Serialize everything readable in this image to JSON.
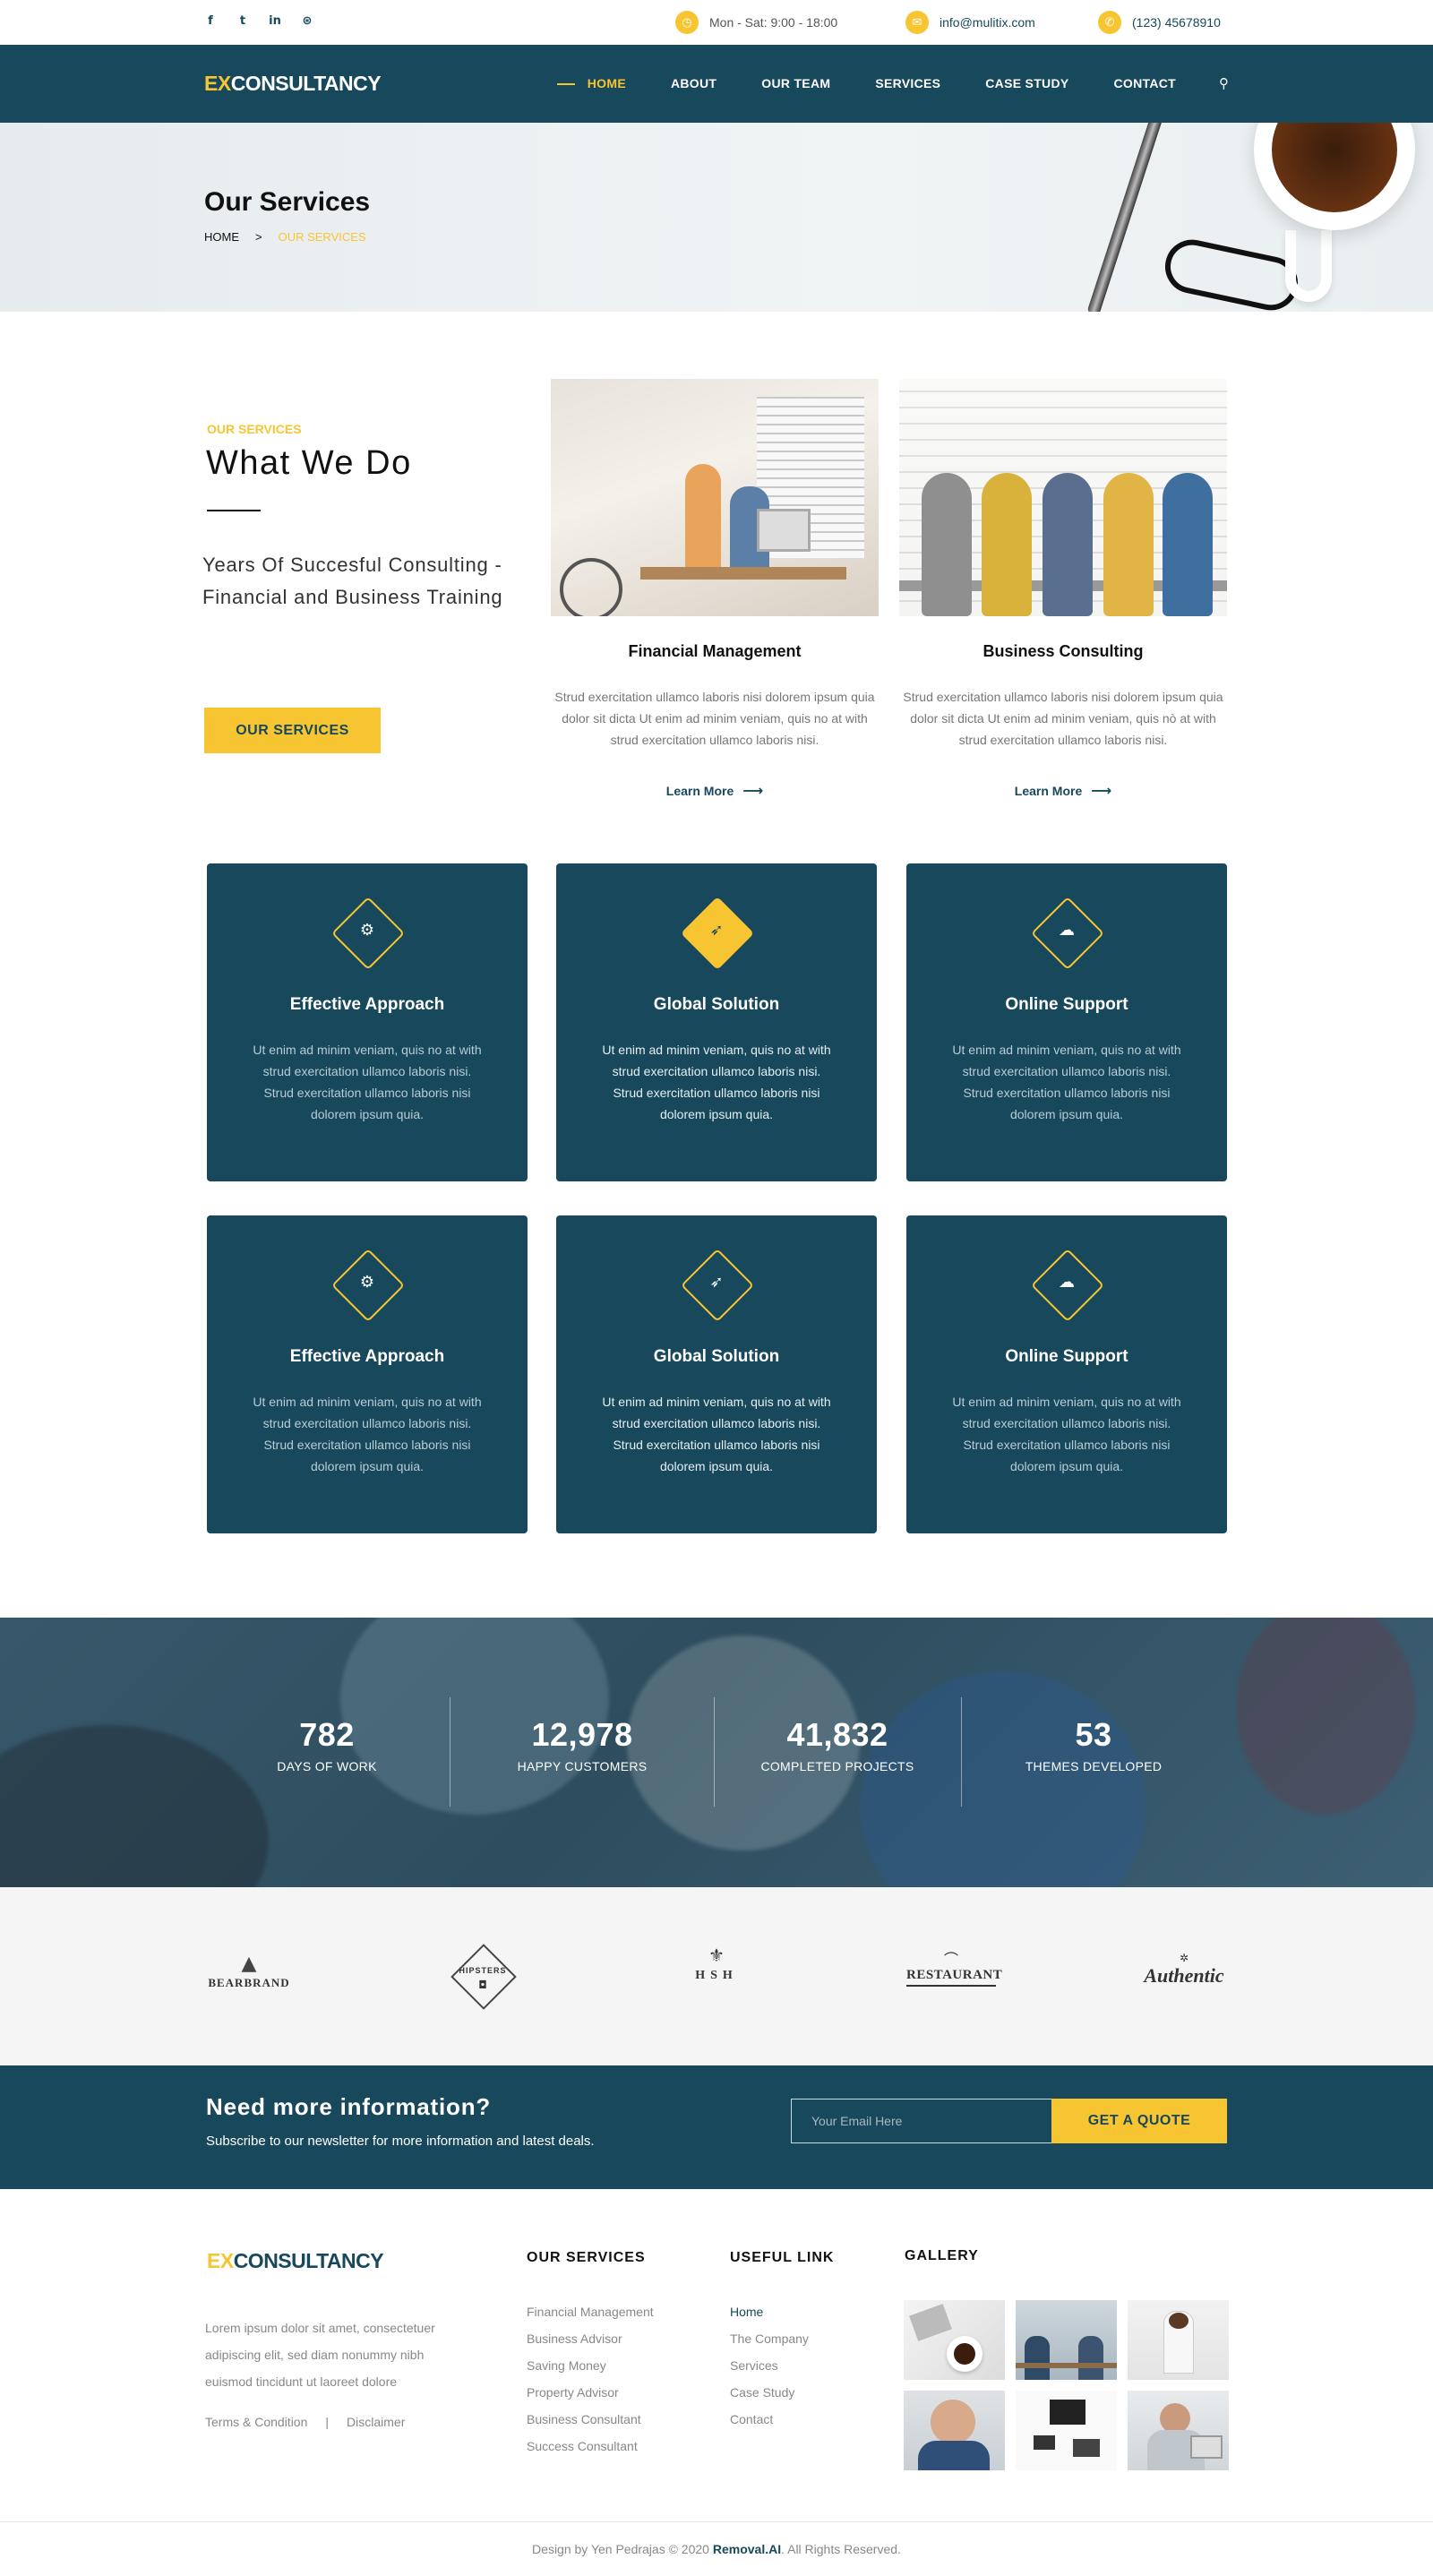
{
  "topbar": {
    "social": [
      "f",
      "t",
      "in",
      "⊛"
    ],
    "hours": "Mon - Sat: 9:00 - 18:00",
    "email": "info@mulitix.com",
    "phone": "(123) 45678910"
  },
  "brand": {
    "ex": "EX",
    "rest": "CONSULTANCY"
  },
  "nav": {
    "items": [
      "HOME",
      "ABOUT",
      "OUR TEAM",
      "SERVICES",
      "CASE STUDY",
      "CONTACT"
    ],
    "active": "HOME"
  },
  "page_header": {
    "title": "Our Services",
    "crumb_home": "HOME",
    "crumb_sep": ">",
    "crumb_current": "OUR SERVICES"
  },
  "intro": {
    "kicker": "OUR SERVICES",
    "title": "What We Do",
    "subtitle": "Years Of Succesful Consulting - Financial and Business Training",
    "button": "OUR SERVICES"
  },
  "service_cards": [
    {
      "title": "Financial Management",
      "text": "Strud exercitation ullamco laboris nisi dolorem ipsum quia dolor sit dicta Ut enim ad minim veniam, quis no at with strud exercitation ullamco laboris nisi.",
      "link": "Learn More"
    },
    {
      "title": "Business Consulting",
      "text": "Strud exercitation ullamco laboris nisi dolorem ipsum quia dolor sit dicta Ut enim ad minim veniam, quis nò at with strud exercitation ullamco laboris nisi.",
      "link": "Learn More"
    }
  ],
  "features": [
    {
      "title": "Effective Approach",
      "icon": "gears-icon",
      "text": "Ut enim ad minim veniam, quis no at with strud exercitation ullamco laboris nisi. Strud exercitation ullamco laboris nisi dolorem ipsum quia."
    },
    {
      "title": "Global Solution",
      "icon": "rocket-icon",
      "text": "Ut enim ad minim veniam, quis no at with strud exercitation ullamco laboris nisi. Strud exercitation ullamco laboris nisi dolorem ipsum quia."
    },
    {
      "title": "Online Support",
      "icon": "chat-icon",
      "text": "Ut enim ad minim veniam, quis no at with strud exercitation ullamco laboris nisi. Strud exercitation ullamco laboris nisi dolorem ipsum quia."
    },
    {
      "title": "Effective Approach",
      "icon": "gears-icon",
      "text": "Ut enim ad minim veniam, quis no at with strud exercitation ullamco laboris nisi. Strud exercitation ullamco laboris nisi dolorem ipsum quia."
    },
    {
      "title": "Global Solution",
      "icon": "rocket-icon",
      "text": "Ut enim ad minim veniam, quis no at with strud exercitation ullamco laboris nisi. Strud exercitation ullamco laboris nisi dolorem ipsum quia."
    },
    {
      "title": "Online Support",
      "icon": "chat-icon",
      "text": "Ut enim ad minim veniam, quis no at with strud exercitation ullamco laboris nisi. Strud exercitation ullamco laboris nisi dolorem ipsum quia."
    }
  ],
  "counters": [
    {
      "num": "782",
      "label": "DAYS OF WORK"
    },
    {
      "num": "12,978",
      "label": "HAPPY CUSTOMERS"
    },
    {
      "num": "41,832",
      "label": "COMPLETED PROJECTS"
    },
    {
      "num": "53",
      "label": "THEMES DEVELOPED"
    }
  ],
  "brands": [
    "BEARBRAND",
    "HIPSTERS",
    "HSH",
    "RESTAURANT",
    "Authentic"
  ],
  "newsletter": {
    "title": "Need more information?",
    "subtitle": "Subscribe to our newsletter for more information and latest deals.",
    "placeholder": "Your Email Here",
    "button": "GET A QUOTE"
  },
  "footer": {
    "about": "Lorem ipsum dolor sit amet, consectetuer adipiscing elit, sed diam nonummy nibh euismod tincidunt ut laoreet dolore",
    "terms": "Terms & Condition",
    "divider": "|",
    "disclaimer": "Disclaimer",
    "services_title": "OUR SERVICES",
    "services": [
      "Financial Management",
      "Business Advisor",
      "Saving Money",
      "Property Advisor",
      "Business Consultant",
      "Success Consultant"
    ],
    "useful_title": "USEFUL LINK",
    "useful": [
      "Home",
      "The Company",
      "Services",
      "Case Study",
      "Contact"
    ],
    "gallery_title": "GALLERY",
    "copyright_pre": "Design by Yen Pedrajas © 2020",
    "copyright_brand": "Removal.AI",
    "copyright_post": ". All Rights Reserved."
  },
  "colors": {
    "primary": "#17485c",
    "accent": "#f7c531"
  }
}
